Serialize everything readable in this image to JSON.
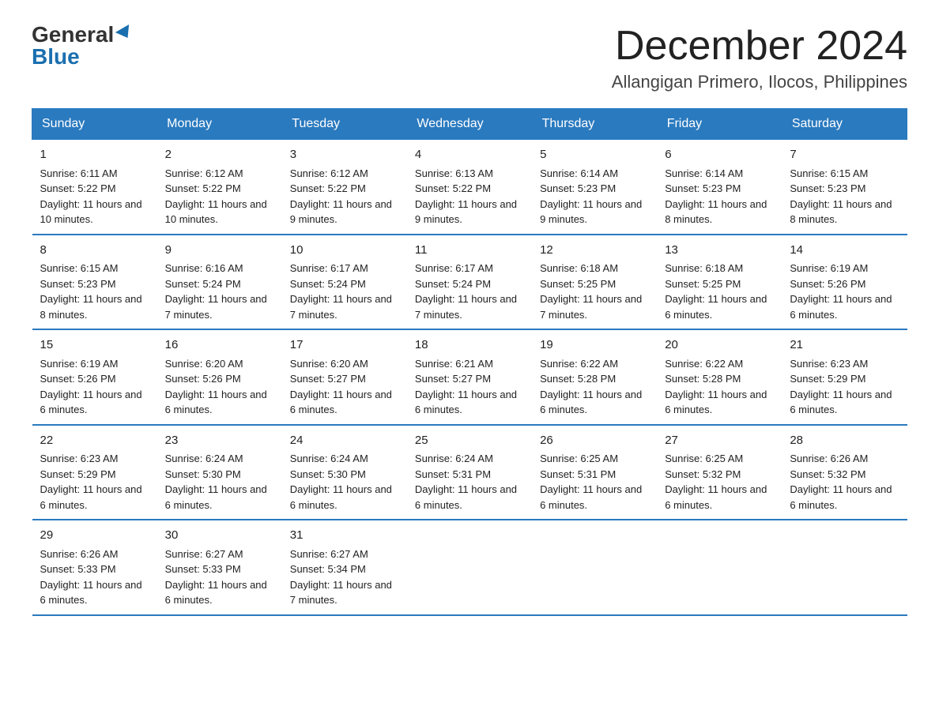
{
  "header": {
    "logo_general": "General",
    "logo_blue": "Blue",
    "main_title": "December 2024",
    "subtitle": "Allangigan Primero, Ilocos, Philippines"
  },
  "days_of_week": [
    "Sunday",
    "Monday",
    "Tuesday",
    "Wednesday",
    "Thursday",
    "Friday",
    "Saturday"
  ],
  "weeks": [
    [
      {
        "day": "1",
        "sunrise": "6:11 AM",
        "sunset": "5:22 PM",
        "daylight": "11 hours and 10 minutes."
      },
      {
        "day": "2",
        "sunrise": "6:12 AM",
        "sunset": "5:22 PM",
        "daylight": "11 hours and 10 minutes."
      },
      {
        "day": "3",
        "sunrise": "6:12 AM",
        "sunset": "5:22 PM",
        "daylight": "11 hours and 9 minutes."
      },
      {
        "day": "4",
        "sunrise": "6:13 AM",
        "sunset": "5:22 PM",
        "daylight": "11 hours and 9 minutes."
      },
      {
        "day": "5",
        "sunrise": "6:14 AM",
        "sunset": "5:23 PM",
        "daylight": "11 hours and 9 minutes."
      },
      {
        "day": "6",
        "sunrise": "6:14 AM",
        "sunset": "5:23 PM",
        "daylight": "11 hours and 8 minutes."
      },
      {
        "day": "7",
        "sunrise": "6:15 AM",
        "sunset": "5:23 PM",
        "daylight": "11 hours and 8 minutes."
      }
    ],
    [
      {
        "day": "8",
        "sunrise": "6:15 AM",
        "sunset": "5:23 PM",
        "daylight": "11 hours and 8 minutes."
      },
      {
        "day": "9",
        "sunrise": "6:16 AM",
        "sunset": "5:24 PM",
        "daylight": "11 hours and 7 minutes."
      },
      {
        "day": "10",
        "sunrise": "6:17 AM",
        "sunset": "5:24 PM",
        "daylight": "11 hours and 7 minutes."
      },
      {
        "day": "11",
        "sunrise": "6:17 AM",
        "sunset": "5:24 PM",
        "daylight": "11 hours and 7 minutes."
      },
      {
        "day": "12",
        "sunrise": "6:18 AM",
        "sunset": "5:25 PM",
        "daylight": "11 hours and 7 minutes."
      },
      {
        "day": "13",
        "sunrise": "6:18 AM",
        "sunset": "5:25 PM",
        "daylight": "11 hours and 6 minutes."
      },
      {
        "day": "14",
        "sunrise": "6:19 AM",
        "sunset": "5:26 PM",
        "daylight": "11 hours and 6 minutes."
      }
    ],
    [
      {
        "day": "15",
        "sunrise": "6:19 AM",
        "sunset": "5:26 PM",
        "daylight": "11 hours and 6 minutes."
      },
      {
        "day": "16",
        "sunrise": "6:20 AM",
        "sunset": "5:26 PM",
        "daylight": "11 hours and 6 minutes."
      },
      {
        "day": "17",
        "sunrise": "6:20 AM",
        "sunset": "5:27 PM",
        "daylight": "11 hours and 6 minutes."
      },
      {
        "day": "18",
        "sunrise": "6:21 AM",
        "sunset": "5:27 PM",
        "daylight": "11 hours and 6 minutes."
      },
      {
        "day": "19",
        "sunrise": "6:22 AM",
        "sunset": "5:28 PM",
        "daylight": "11 hours and 6 minutes."
      },
      {
        "day": "20",
        "sunrise": "6:22 AM",
        "sunset": "5:28 PM",
        "daylight": "11 hours and 6 minutes."
      },
      {
        "day": "21",
        "sunrise": "6:23 AM",
        "sunset": "5:29 PM",
        "daylight": "11 hours and 6 minutes."
      }
    ],
    [
      {
        "day": "22",
        "sunrise": "6:23 AM",
        "sunset": "5:29 PM",
        "daylight": "11 hours and 6 minutes."
      },
      {
        "day": "23",
        "sunrise": "6:24 AM",
        "sunset": "5:30 PM",
        "daylight": "11 hours and 6 minutes."
      },
      {
        "day": "24",
        "sunrise": "6:24 AM",
        "sunset": "5:30 PM",
        "daylight": "11 hours and 6 minutes."
      },
      {
        "day": "25",
        "sunrise": "6:24 AM",
        "sunset": "5:31 PM",
        "daylight": "11 hours and 6 minutes."
      },
      {
        "day": "26",
        "sunrise": "6:25 AM",
        "sunset": "5:31 PM",
        "daylight": "11 hours and 6 minutes."
      },
      {
        "day": "27",
        "sunrise": "6:25 AM",
        "sunset": "5:32 PM",
        "daylight": "11 hours and 6 minutes."
      },
      {
        "day": "28",
        "sunrise": "6:26 AM",
        "sunset": "5:32 PM",
        "daylight": "11 hours and 6 minutes."
      }
    ],
    [
      {
        "day": "29",
        "sunrise": "6:26 AM",
        "sunset": "5:33 PM",
        "daylight": "11 hours and 6 minutes."
      },
      {
        "day": "30",
        "sunrise": "6:27 AM",
        "sunset": "5:33 PM",
        "daylight": "11 hours and 6 minutes."
      },
      {
        "day": "31",
        "sunrise": "6:27 AM",
        "sunset": "5:34 PM",
        "daylight": "11 hours and 7 minutes."
      },
      null,
      null,
      null,
      null
    ]
  ]
}
